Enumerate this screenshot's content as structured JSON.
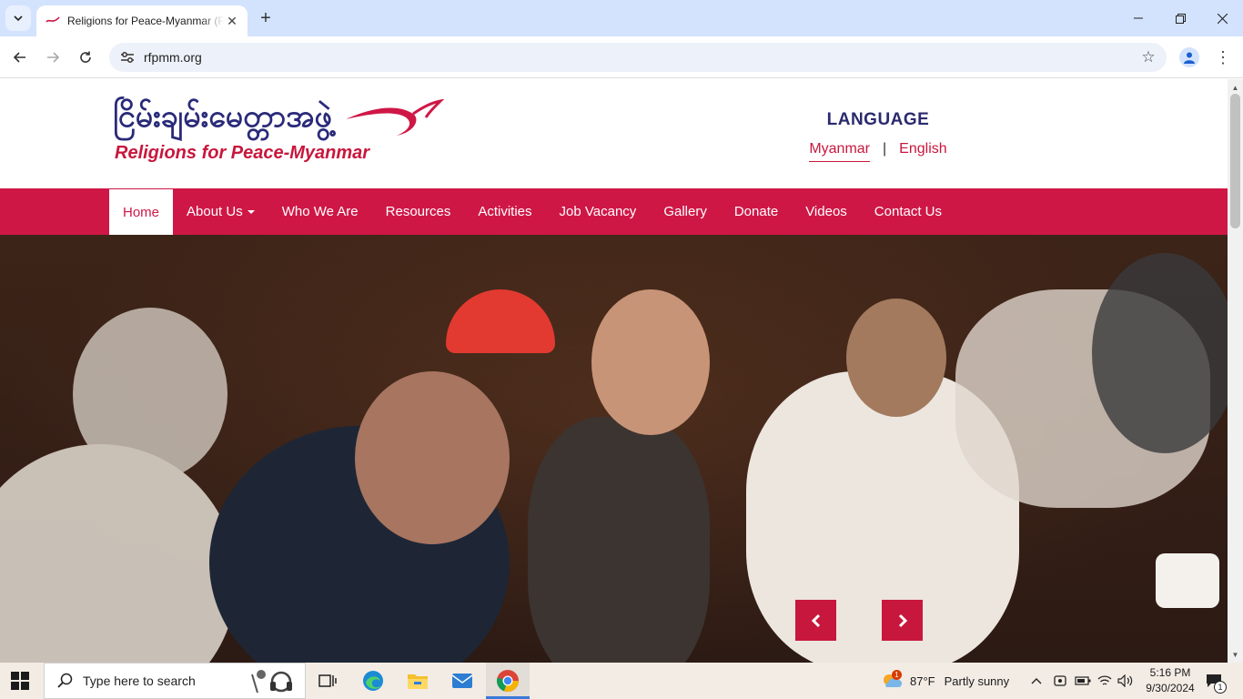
{
  "browser": {
    "tab_title": "Religions for Peace-Myanmar (RfP-Myanmar)",
    "url": "rfpmm.org",
    "new_tab_symbol": "+",
    "close_symbol": "✕"
  },
  "site": {
    "logo_myanmar": "ငြိမ်းချမ်းမေတ္တာအဖွဲ့",
    "logo_english": "Religions for Peace-Myanmar",
    "language_heading": "LANGUAGE",
    "language_options": [
      "Myanmar",
      "English"
    ],
    "language_separator": "|",
    "active_language": "Myanmar",
    "nav": [
      "Home",
      "About Us",
      "Who We Are",
      "Resources",
      "Activities",
      "Job Vacancy",
      "Gallery",
      "Donate",
      "Videos",
      "Contact Us"
    ],
    "active_nav": "Home",
    "brand_color": "#cf1746",
    "heading_color": "#2a2a6e"
  },
  "taskbar": {
    "search_placeholder": "Type here to search",
    "weather_temp": "87°F",
    "weather_desc": "Partly sunny",
    "weather_badge": "1",
    "time": "5:16 PM",
    "date": "9/30/2024",
    "notification_count": "1"
  }
}
